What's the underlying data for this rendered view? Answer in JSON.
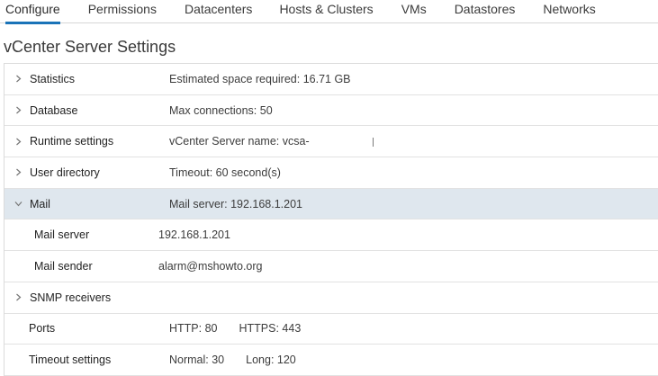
{
  "tabs": [
    {
      "label": "Configure",
      "active": true
    },
    {
      "label": "Permissions",
      "active": false
    },
    {
      "label": "Datacenters",
      "active": false
    },
    {
      "label": "Hosts & Clusters",
      "active": false
    },
    {
      "label": "VMs",
      "active": false
    },
    {
      "label": "Datastores",
      "active": false
    },
    {
      "label": "Networks",
      "active": false
    }
  ],
  "page_title": "vCenter Server Settings",
  "accent_color": "#1a73b8",
  "selected_row_color": "#dfe7ee",
  "rows": {
    "statistics": {
      "label": "Statistics",
      "value": "Estimated space required: 16.71 GB",
      "icon": "chevron-right-icon"
    },
    "database": {
      "label": "Database",
      "value": "Max connections: 50",
      "icon": "chevron-right-icon"
    },
    "runtime": {
      "label": "Runtime settings",
      "value": "vCenter Server name: vcsa-",
      "icon": "chevron-right-icon"
    },
    "user_directory": {
      "label": "User directory",
      "value": "Timeout: 60 second(s)",
      "icon": "chevron-right-icon"
    },
    "mail": {
      "label": "Mail",
      "value": "Mail server: 192.168.1.201",
      "icon": "chevron-down-icon",
      "expanded": true
    },
    "mail_server": {
      "label": "Mail server",
      "value": "192.168.1.201"
    },
    "mail_sender": {
      "label": "Mail sender",
      "value": "alarm@mshowto.org"
    },
    "snmp": {
      "label": "SNMP receivers",
      "value": "",
      "icon": "chevron-right-icon"
    },
    "ports": {
      "label": "Ports",
      "http": "HTTP: 80",
      "https": "HTTPS: 443"
    },
    "timeout": {
      "label": "Timeout settings",
      "normal": "Normal: 30",
      "long": "Long: 120"
    }
  }
}
